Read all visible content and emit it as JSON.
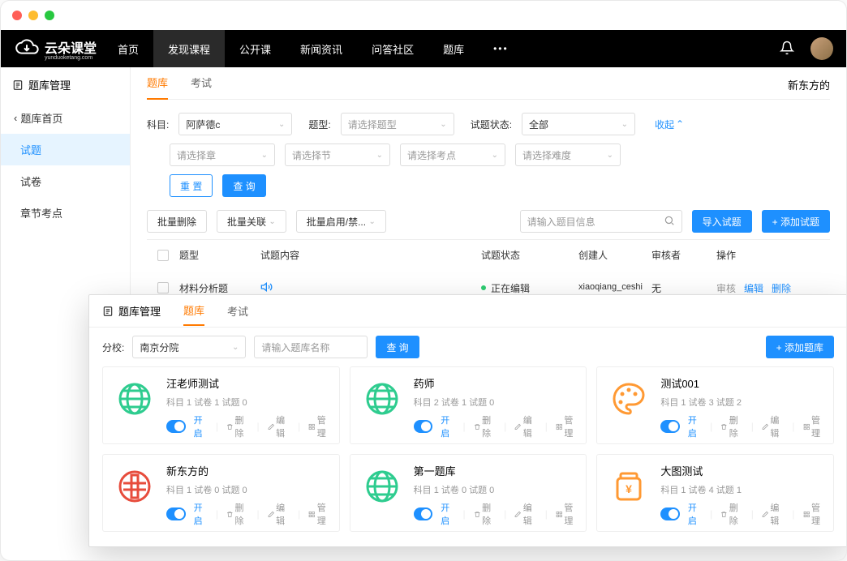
{
  "logo": {
    "name": "云朵课堂",
    "sub": "yunduoketang.com"
  },
  "nav": {
    "home": "首页",
    "discover": "发现课程",
    "open": "公开课",
    "news": "新闻资讯",
    "qa": "问答社区",
    "bank": "题库"
  },
  "sidebar": {
    "title": "题库管理",
    "back": "题库首页",
    "items": [
      "试题",
      "试卷",
      "章节考点"
    ]
  },
  "tabs": {
    "tiku": "题库",
    "kaoshi": "考试"
  },
  "owner": "新东方的",
  "filters": {
    "subject_label": "科目:",
    "subject_value": "阿萨德c",
    "type_label": "题型:",
    "type_placeholder": "请选择题型",
    "status_label": "试题状态:",
    "status_value": "全部",
    "collapse": "收起",
    "chapter_ph": "请选择章",
    "section_ph": "请选择节",
    "point_ph": "请选择考点",
    "difficulty_ph": "请选择难度",
    "reset": "重 置",
    "query": "查 询"
  },
  "bulk": {
    "delete": "批量删除",
    "relate": "批量关联",
    "enable": "批量启用/禁...",
    "search_ph": "请输入题目信息",
    "import": "导入试题",
    "add": "+ 添加试题"
  },
  "table": {
    "headers": {
      "type": "题型",
      "content": "试题内容",
      "status": "试题状态",
      "creator": "创建人",
      "reviewer": "审核者",
      "ops": "操作"
    },
    "rows": [
      {
        "type": "材料分析题",
        "status": "正在编辑",
        "creator": "xiaoqiang_ceshi",
        "reviewer": "无",
        "ops": {
          "review": "审核",
          "edit": "编辑",
          "delete": "删除"
        }
      }
    ]
  },
  "panel2": {
    "title": "题库管理",
    "branch_label": "分校:",
    "branch_value": "南京分院",
    "name_ph": "请输入题库名称",
    "query": "查 询",
    "add": "+ 添加题库",
    "ops": {
      "open": "开启",
      "delete": "删除",
      "edit": "编辑",
      "manage": "管理"
    },
    "cards": [
      {
        "title": "汪老师测试",
        "meta": "科目 1  试卷 1  试题 0",
        "icon": "globe-green"
      },
      {
        "title": "药师",
        "meta": "科目 2  试卷 1  试题 0",
        "icon": "globe-green"
      },
      {
        "title": "测试001",
        "meta": "科目 1  试卷 3  试题 2",
        "icon": "palette-orange"
      },
      {
        "title": "新东方的",
        "meta": "科目 1  试卷 0  试题 0",
        "icon": "coin-red"
      },
      {
        "title": "第一题库",
        "meta": "科目 1  试卷 0  试题 0",
        "icon": "globe-green"
      },
      {
        "title": "大图测试",
        "meta": "科目 1  试卷 4  试题 1",
        "icon": "jar-orange"
      }
    ]
  }
}
